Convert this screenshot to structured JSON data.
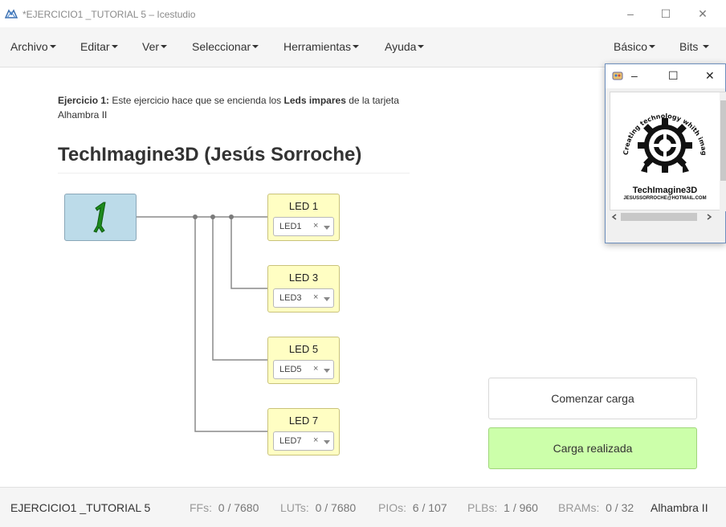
{
  "window": {
    "title": "*EJERCICIO1 _TUTORIAL 5 – Icestudio"
  },
  "titlebar_buttons": {
    "minimize": "–",
    "maximize": "☐",
    "close": "✕"
  },
  "menu": {
    "left": [
      "Archivo",
      "Editar",
      "Ver",
      "Seleccionar",
      "Herramientas",
      "Ayuda"
    ],
    "right": [
      "Básico",
      "Bits"
    ]
  },
  "content": {
    "info_label": "Ejercicio 1:",
    "info_text_1": " Este ejercicio hace que se encienda los ",
    "info_bold": "Leds impares",
    "info_text_2": " de la tarjeta Alhambra II",
    "heading": "TechImagine3D (Jesús Sorroche)"
  },
  "constant_block": {
    "value": "1",
    "color": "#1d8a1d"
  },
  "led_blocks": [
    {
      "name": "LED 1",
      "pin": "LED1",
      "clear": "×"
    },
    {
      "name": "LED 3",
      "pin": "LED3",
      "clear": "×"
    },
    {
      "name": "LED 5",
      "pin": "LED5",
      "clear": "×"
    },
    {
      "name": "LED 7",
      "pin": "LED7",
      "clear": "×"
    }
  ],
  "actions": {
    "start_upload": "Comenzar carga",
    "upload_done": "Carga realizada"
  },
  "status": {
    "project": "EJERCICIO1 _TUTORIAL 5",
    "ffs_label": "FFs:",
    "ffs_value": "0 / 7680",
    "luts_label": "LUTs:",
    "luts_value": "0 / 7680",
    "pios_label": "PIOs:",
    "pios_value": "6 / 107",
    "plbs_label": "PLBs:",
    "plbs_value": "1 / 960",
    "brams_label": "BRAMs:",
    "brams_value": "0 / 32",
    "board": "Alhambra II"
  },
  "image_viewer": {
    "logo_text": "TechImagine3D",
    "logo_email": "JESUSSORROCHE@HOTMAIL.COM",
    "logo_arc_text": "Creating technology whith imagination"
  }
}
